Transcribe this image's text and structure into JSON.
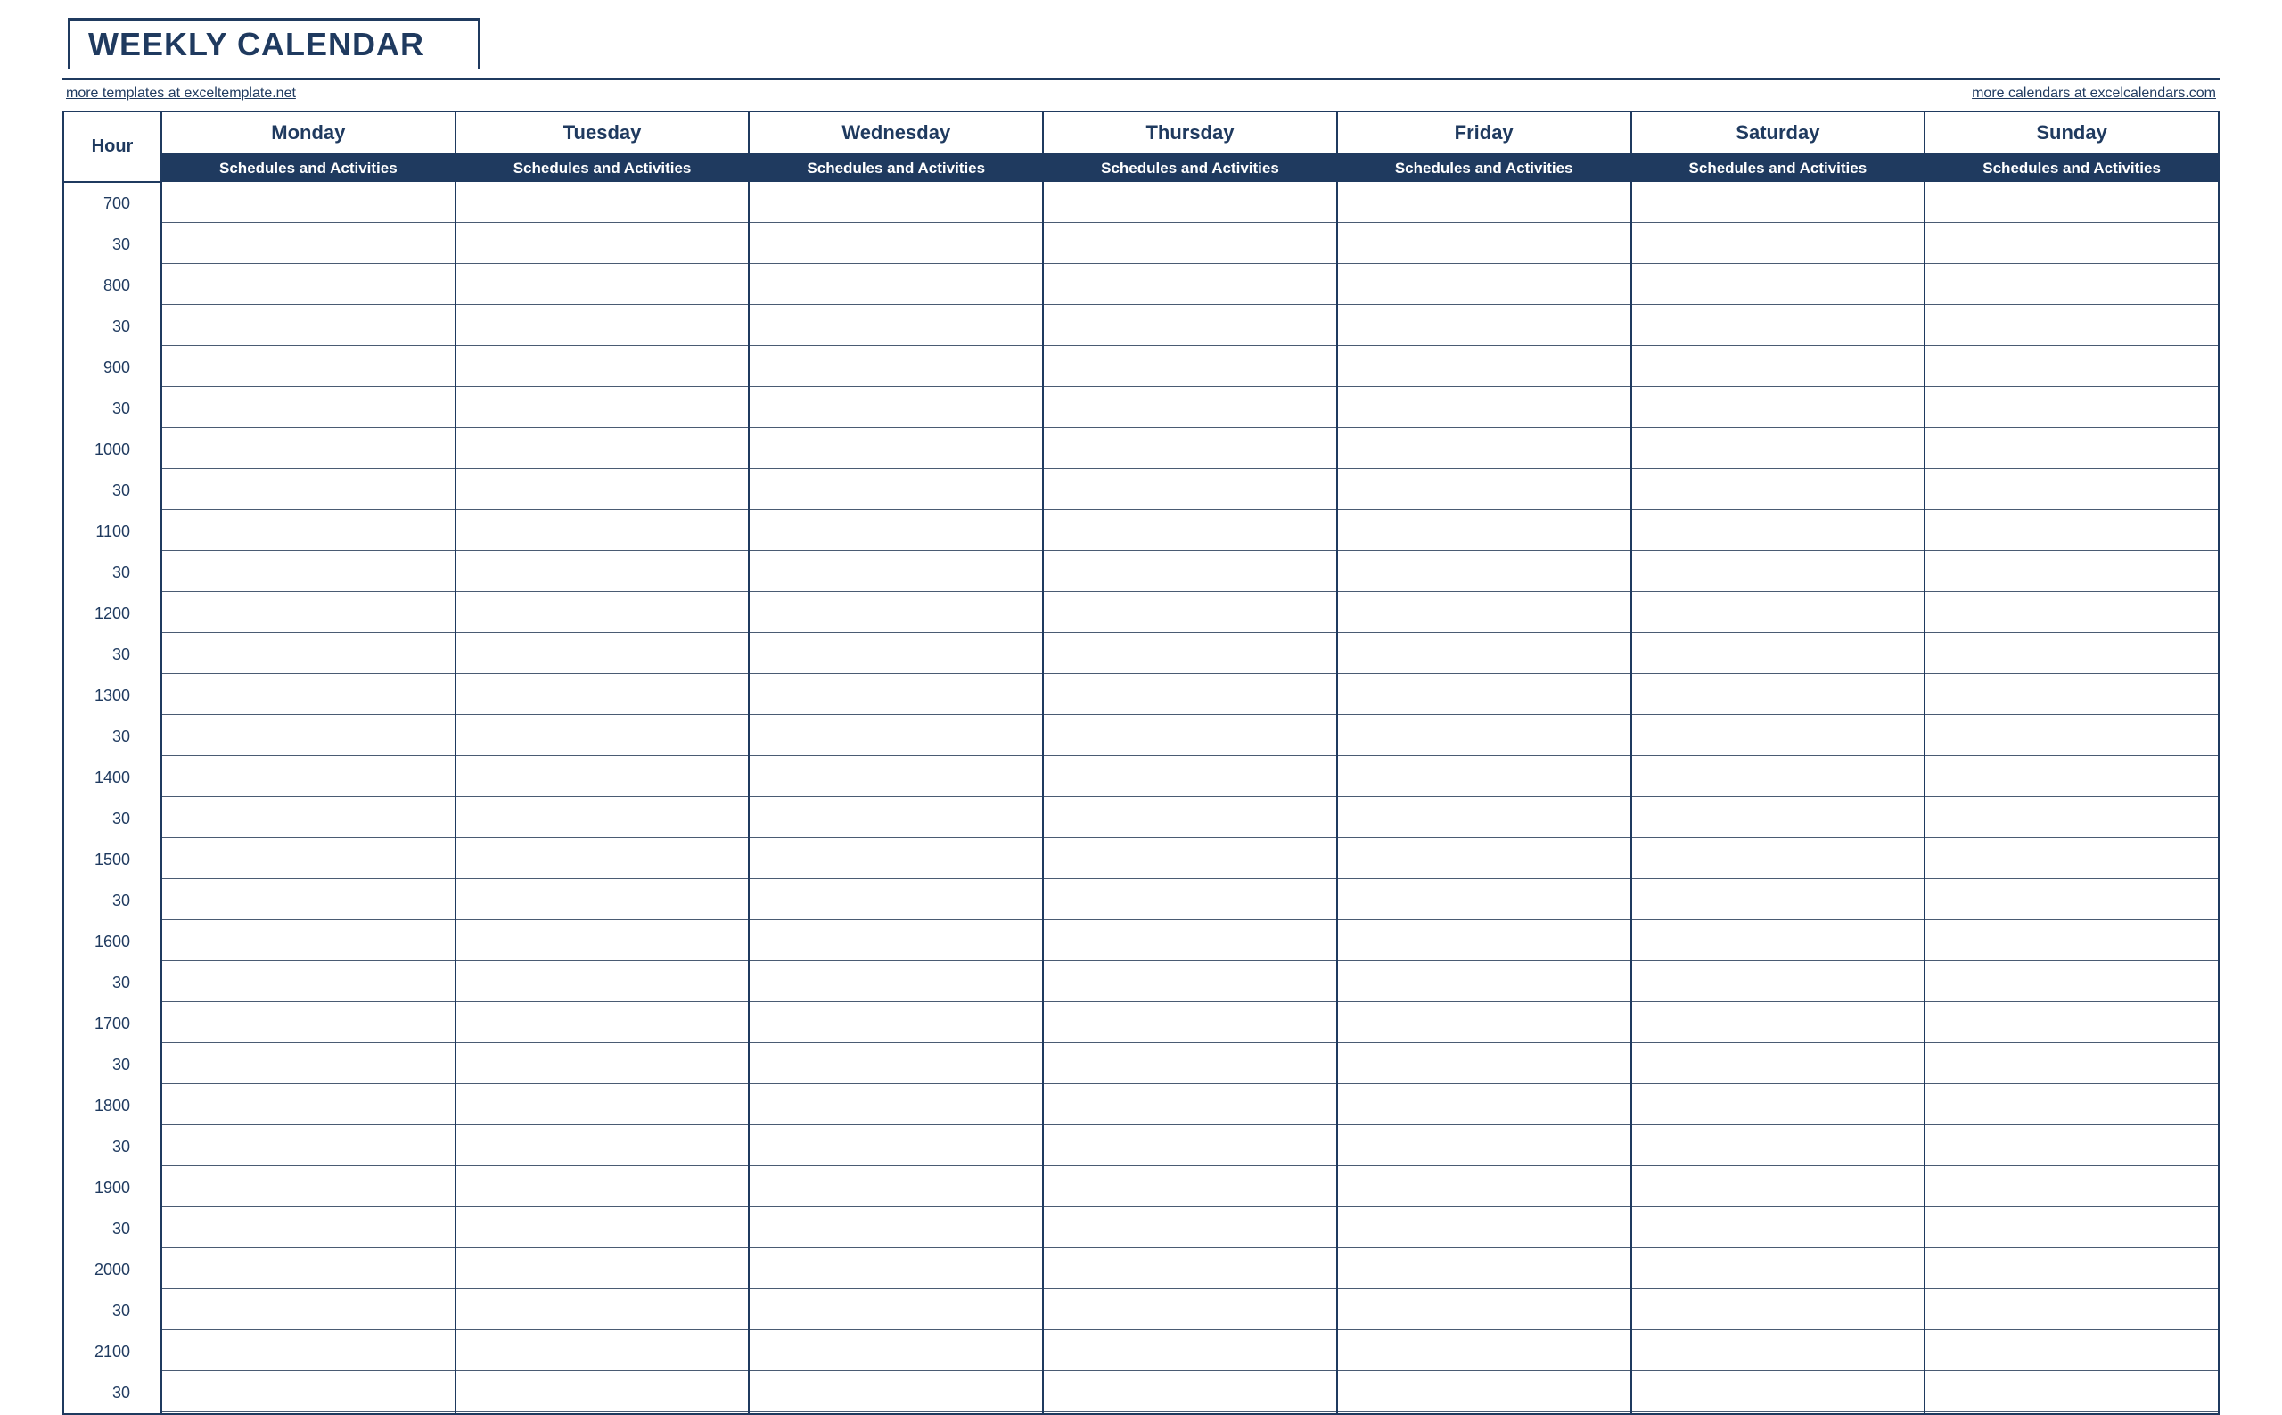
{
  "title": "WEEKLY CALENDAR",
  "links": {
    "left": "more templates at exceltemplate.net",
    "right": "more calendars at excelcalendars.com"
  },
  "headers": {
    "hour": "Hour",
    "days": [
      "Monday",
      "Tuesday",
      "Wednesday",
      "Thursday",
      "Friday",
      "Saturday",
      "Sunday"
    ],
    "sub": "Schedules and Activities"
  },
  "time_slots": [
    {
      "hour": "7",
      "min": "00"
    },
    {
      "hour": "",
      "min": "30"
    },
    {
      "hour": "8",
      "min": "00"
    },
    {
      "hour": "",
      "min": "30"
    },
    {
      "hour": "9",
      "min": "00"
    },
    {
      "hour": "",
      "min": "30"
    },
    {
      "hour": "10",
      "min": "00"
    },
    {
      "hour": "",
      "min": "30"
    },
    {
      "hour": "11",
      "min": "00"
    },
    {
      "hour": "",
      "min": "30"
    },
    {
      "hour": "12",
      "min": "00"
    },
    {
      "hour": "",
      "min": "30"
    },
    {
      "hour": "13",
      "min": "00"
    },
    {
      "hour": "",
      "min": "30"
    },
    {
      "hour": "14",
      "min": "00"
    },
    {
      "hour": "",
      "min": "30"
    },
    {
      "hour": "15",
      "min": "00"
    },
    {
      "hour": "",
      "min": "30"
    },
    {
      "hour": "16",
      "min": "00"
    },
    {
      "hour": "",
      "min": "30"
    },
    {
      "hour": "17",
      "min": "00"
    },
    {
      "hour": "",
      "min": "30"
    },
    {
      "hour": "18",
      "min": "00"
    },
    {
      "hour": "",
      "min": "30"
    },
    {
      "hour": "19",
      "min": "00"
    },
    {
      "hour": "",
      "min": "30"
    },
    {
      "hour": "20",
      "min": "00"
    },
    {
      "hour": "",
      "min": "30"
    },
    {
      "hour": "21",
      "min": "00"
    },
    {
      "hour": "",
      "min": "30"
    }
  ],
  "colors": {
    "accent": "#1f3a5f"
  }
}
